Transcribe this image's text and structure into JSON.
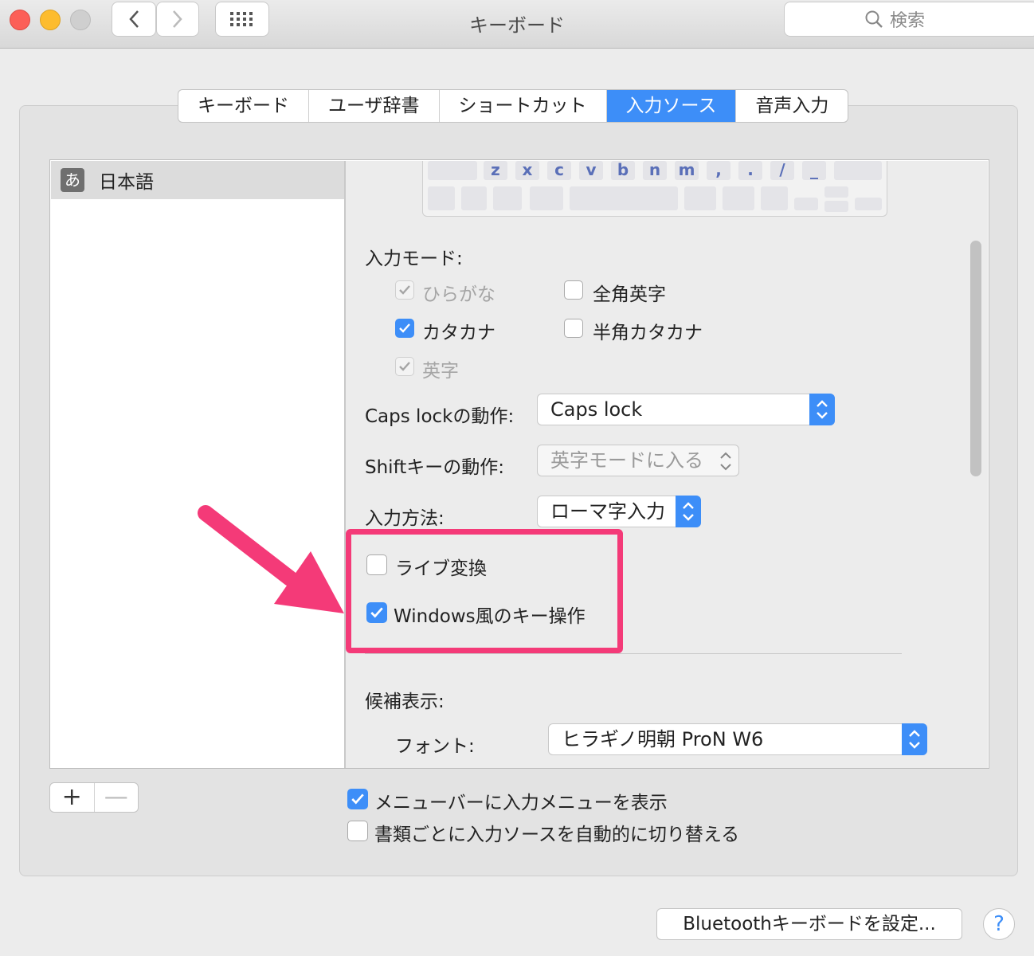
{
  "window": {
    "title": "キーボード",
    "search_placeholder": "検索"
  },
  "tabs": [
    {
      "label": "キーボード",
      "active": false
    },
    {
      "label": "ユーザ辞書",
      "active": false
    },
    {
      "label": "ショートカット",
      "active": false
    },
    {
      "label": "入力ソース",
      "active": true
    },
    {
      "label": "音声入力",
      "active": false
    }
  ],
  "sources": {
    "items": [
      {
        "icon_text": "あ",
        "label": "日本語"
      }
    ]
  },
  "keyboard": {
    "keys": [
      "z",
      "x",
      "c",
      "v",
      "b",
      "n",
      "m",
      ",",
      ".",
      "/",
      "_"
    ]
  },
  "input_modes": {
    "title": "入力モード:",
    "hiragana": {
      "label": "ひらがな",
      "checked": true,
      "disabled": true
    },
    "fullwidth_roman": {
      "label": "全角英字",
      "checked": false
    },
    "katakana": {
      "label": "カタカナ",
      "checked": true
    },
    "halfwidth_katakana": {
      "label": "半角カタカナ",
      "checked": false
    },
    "roman": {
      "label": "英字",
      "checked": true,
      "disabled": true
    }
  },
  "caps_lock": {
    "label": "Caps lockの動作:",
    "value": "Caps lock"
  },
  "shift": {
    "label": "Shiftキーの動作:",
    "value": "英字モードに入る"
  },
  "input_method": {
    "label": "入力方法:",
    "value": "ローマ字入力"
  },
  "live_conversion": {
    "label": "ライブ変換",
    "checked": false
  },
  "windows_keys": {
    "label": "Windows風のキー操作",
    "checked": true
  },
  "candidates": {
    "title": "候補表示:",
    "font_label": "フォント:",
    "font_value": "ヒラギノ明朝 ProN W6"
  },
  "list_buttons": {
    "add": "+",
    "remove": "—"
  },
  "show_menu": {
    "label": "メニューバーに入力メニューを表示",
    "checked": true
  },
  "auto_switch": {
    "label": "書類ごとに入力ソースを自動的に切り替える",
    "checked": false
  },
  "bluetooth_button": "Bluetoothキーボードを設定...",
  "help_button": "?",
  "colors": {
    "accent": "#3d8ef8",
    "highlight": "#f43a78"
  }
}
